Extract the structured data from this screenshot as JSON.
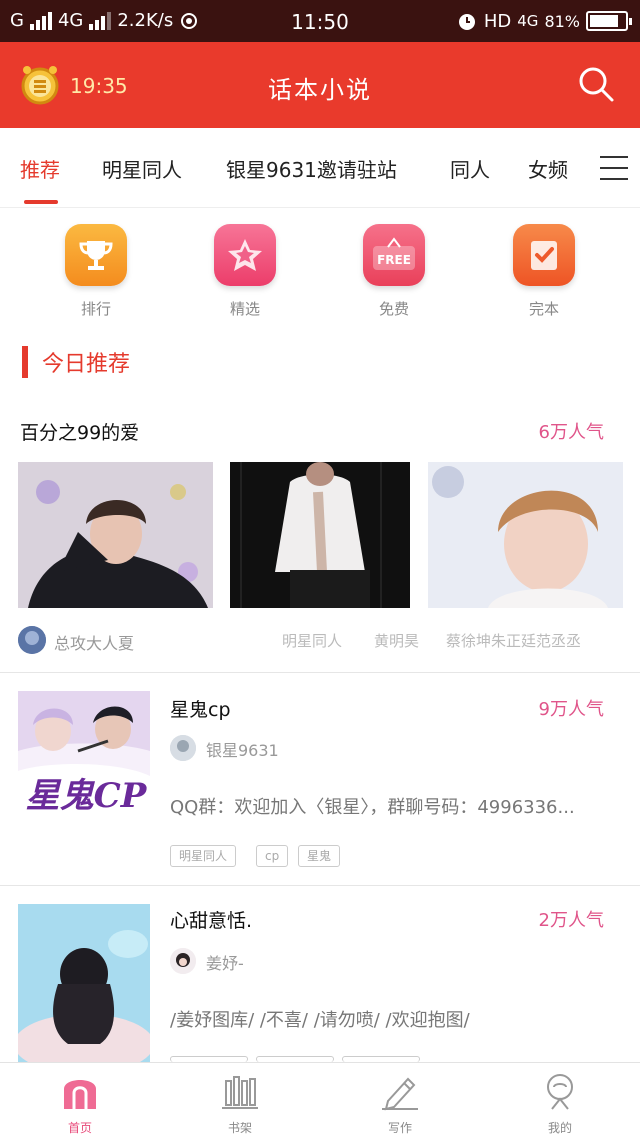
{
  "status_bar": {
    "carrier": "G",
    "network": "4G",
    "speed": "2.2K/s",
    "time": "11:50",
    "hd": "HD",
    "network2": "4G",
    "battery": "81%",
    "battery_level": 0.81
  },
  "app_bar": {
    "time": "19:35",
    "title": "话本小说",
    "clock_icon": "alarm-clock-icon",
    "search_icon": "search-icon"
  },
  "tabs": [
    {
      "label": "推荐",
      "active": true
    },
    {
      "label": "明星同人",
      "active": false
    },
    {
      "label": "银星9631邀请驻站",
      "active": false
    },
    {
      "label": "同人",
      "active": false
    },
    {
      "label": "女频",
      "active": false
    }
  ],
  "quick_links": [
    {
      "label": "排行",
      "icon": "trophy-icon",
      "color": "#f7a12b"
    },
    {
      "label": "精选",
      "icon": "star-icon",
      "color": "#f2557f"
    },
    {
      "label": "免费",
      "icon": "free-sign-icon",
      "color": "#f0506a"
    },
    {
      "label": "完本",
      "icon": "check-book-icon",
      "color": "#f26a3b"
    }
  ],
  "section": {
    "title": "今日推荐"
  },
  "featured": {
    "title": "百分之99的爱",
    "popularity": "6万人气",
    "author": "总攻大人夏",
    "tags": [
      "明星同人",
      "黄明昊",
      "蔡徐坤朱正廷范丞丞"
    ]
  },
  "books": [
    {
      "title": "星鬼cp",
      "popularity": "9万人气",
      "author": "银星9631",
      "description": "QQ群：欢迎加入〈银星〉，群聊号码：4996336...",
      "tags": [
        "明星同人",
        "cp",
        "星鬼"
      ],
      "cover_text": "星鬼CP"
    },
    {
      "title": "心甜意恬.",
      "popularity": "2万人气",
      "author": "姜妤-",
      "description": "/姜妤图库/ /不喜/ /请勿喷/ /欢迎抱图/",
      "tags": []
    }
  ],
  "bottom_nav": [
    {
      "label": "首页",
      "icon": "home-icon",
      "active": true
    },
    {
      "label": "书架",
      "icon": "bookshelf-icon",
      "active": false
    },
    {
      "label": "写作",
      "icon": "pencil-icon",
      "active": false
    },
    {
      "label": "我的",
      "icon": "profile-icon",
      "active": false
    }
  ]
}
